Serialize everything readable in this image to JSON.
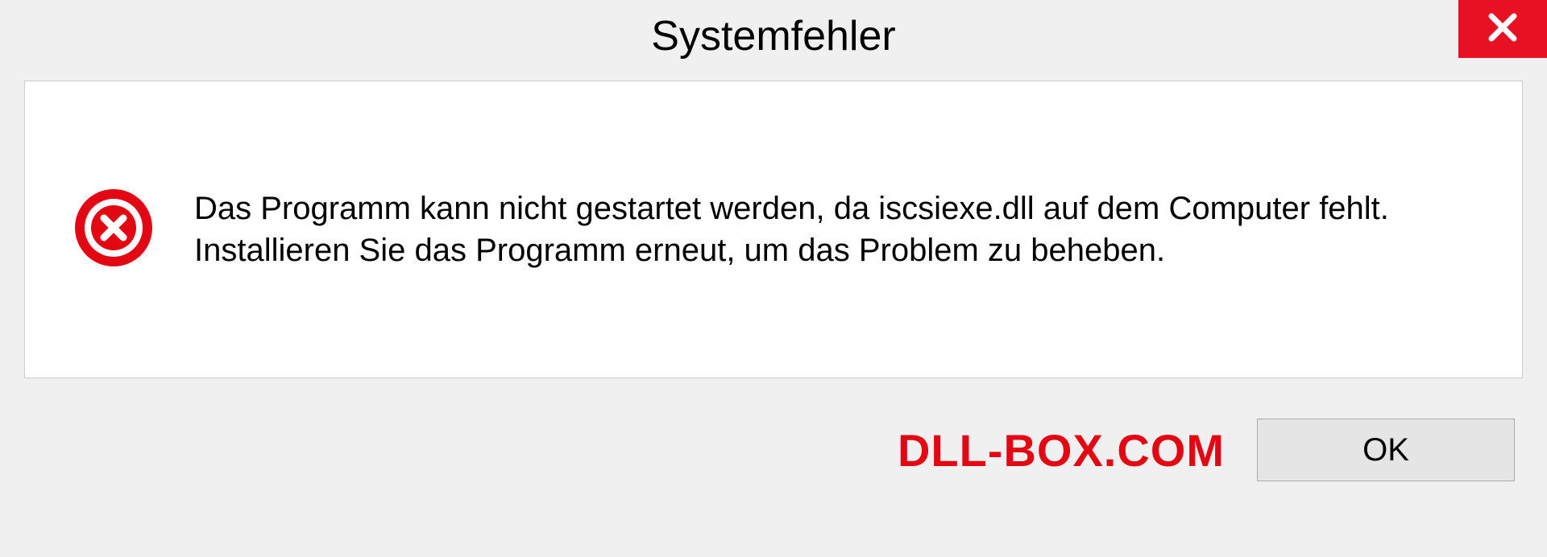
{
  "titlebar": {
    "title": "Systemfehler"
  },
  "content": {
    "message": "Das Programm kann nicht gestartet werden, da iscsiexe.dll auf dem Computer fehlt. Installieren Sie das Programm erneut, um das Problem zu beheben."
  },
  "footer": {
    "watermark": "DLL-BOX.COM",
    "ok_label": "OK"
  },
  "colors": {
    "close_bg": "#e81123",
    "error_icon": "#e30613",
    "watermark": "#e30613"
  }
}
